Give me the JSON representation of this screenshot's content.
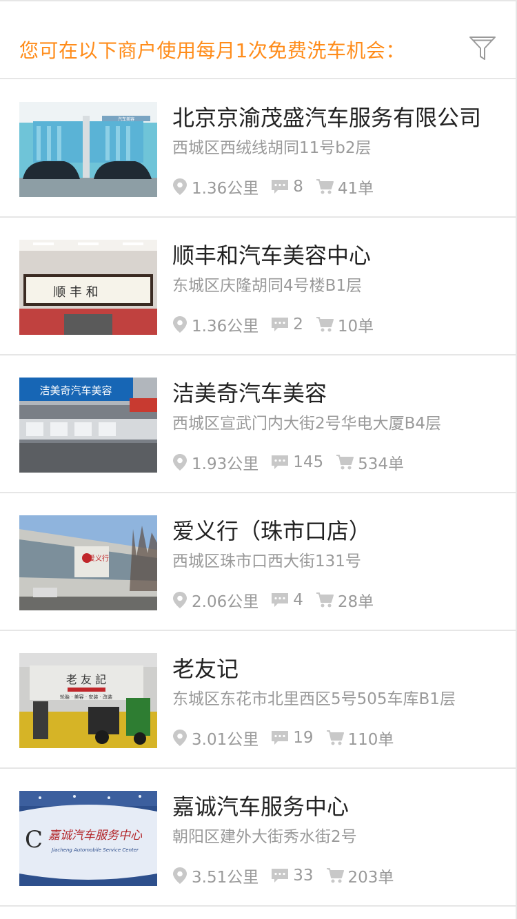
{
  "header": {
    "title": "您可在以下商户使用每月1次免费洗车机会："
  },
  "colors": {
    "accent": "#ff8c1a",
    "divider": "#e6e6e6",
    "meta_text": "#9a9a9a",
    "icon": "#c8c8c8"
  },
  "merchants": [
    {
      "name": "北京京渝茂盛汽车服务有限公司",
      "address": "西城区西绒线胡同11号b2层",
      "distance": "1.36公里",
      "comments": "8",
      "orders": "41单",
      "photo": "car-wash-bay-photo"
    },
    {
      "name": "顺丰和汽车美容中心",
      "address": "东城区庆隆胡同4号楼B1层",
      "distance": "1.36公里",
      "comments": "2",
      "orders": "10单",
      "photo": "calligraphy-sign-photo"
    },
    {
      "name": "洁美奇汽车美容",
      "address": "西城区宣武门内大街2号华电大厦B4层",
      "distance": "1.93公里",
      "comments": "145",
      "orders": "534单",
      "photo": "garage-interior-photo"
    },
    {
      "name": "爱义行（珠市口店）",
      "address": "西城区珠市口西大街131号",
      "distance": "2.06公里",
      "comments": "4",
      "orders": "28单",
      "photo": "storefront-building-photo"
    },
    {
      "name": "老友记",
      "address": "东城区东花市北里西区5号505车库B1层",
      "distance": "3.01公里",
      "comments": "19",
      "orders": "110单",
      "photo": "motorcycle-shop-photo"
    },
    {
      "name": "嘉诚汽车服务中心",
      "address": "朝阳区建外大街秀水街2号",
      "distance": "3.51公里",
      "comments": "33",
      "orders": "203单",
      "photo": "service-center-sign-photo"
    }
  ],
  "photo_text": {
    "sign_1": "汽车美容",
    "sign_2": "顺 丰 和",
    "sign_3": "洁美奇汽车美容",
    "sign_4": "爱义行",
    "sign_5": "老 友 記",
    "sign_5_sub": "轮胎 · 美容 · 安装 · 改装",
    "sign_6": "嘉诚汽车服务中心",
    "sign_6_sub": "Jiacheng Automobile Service Center"
  }
}
